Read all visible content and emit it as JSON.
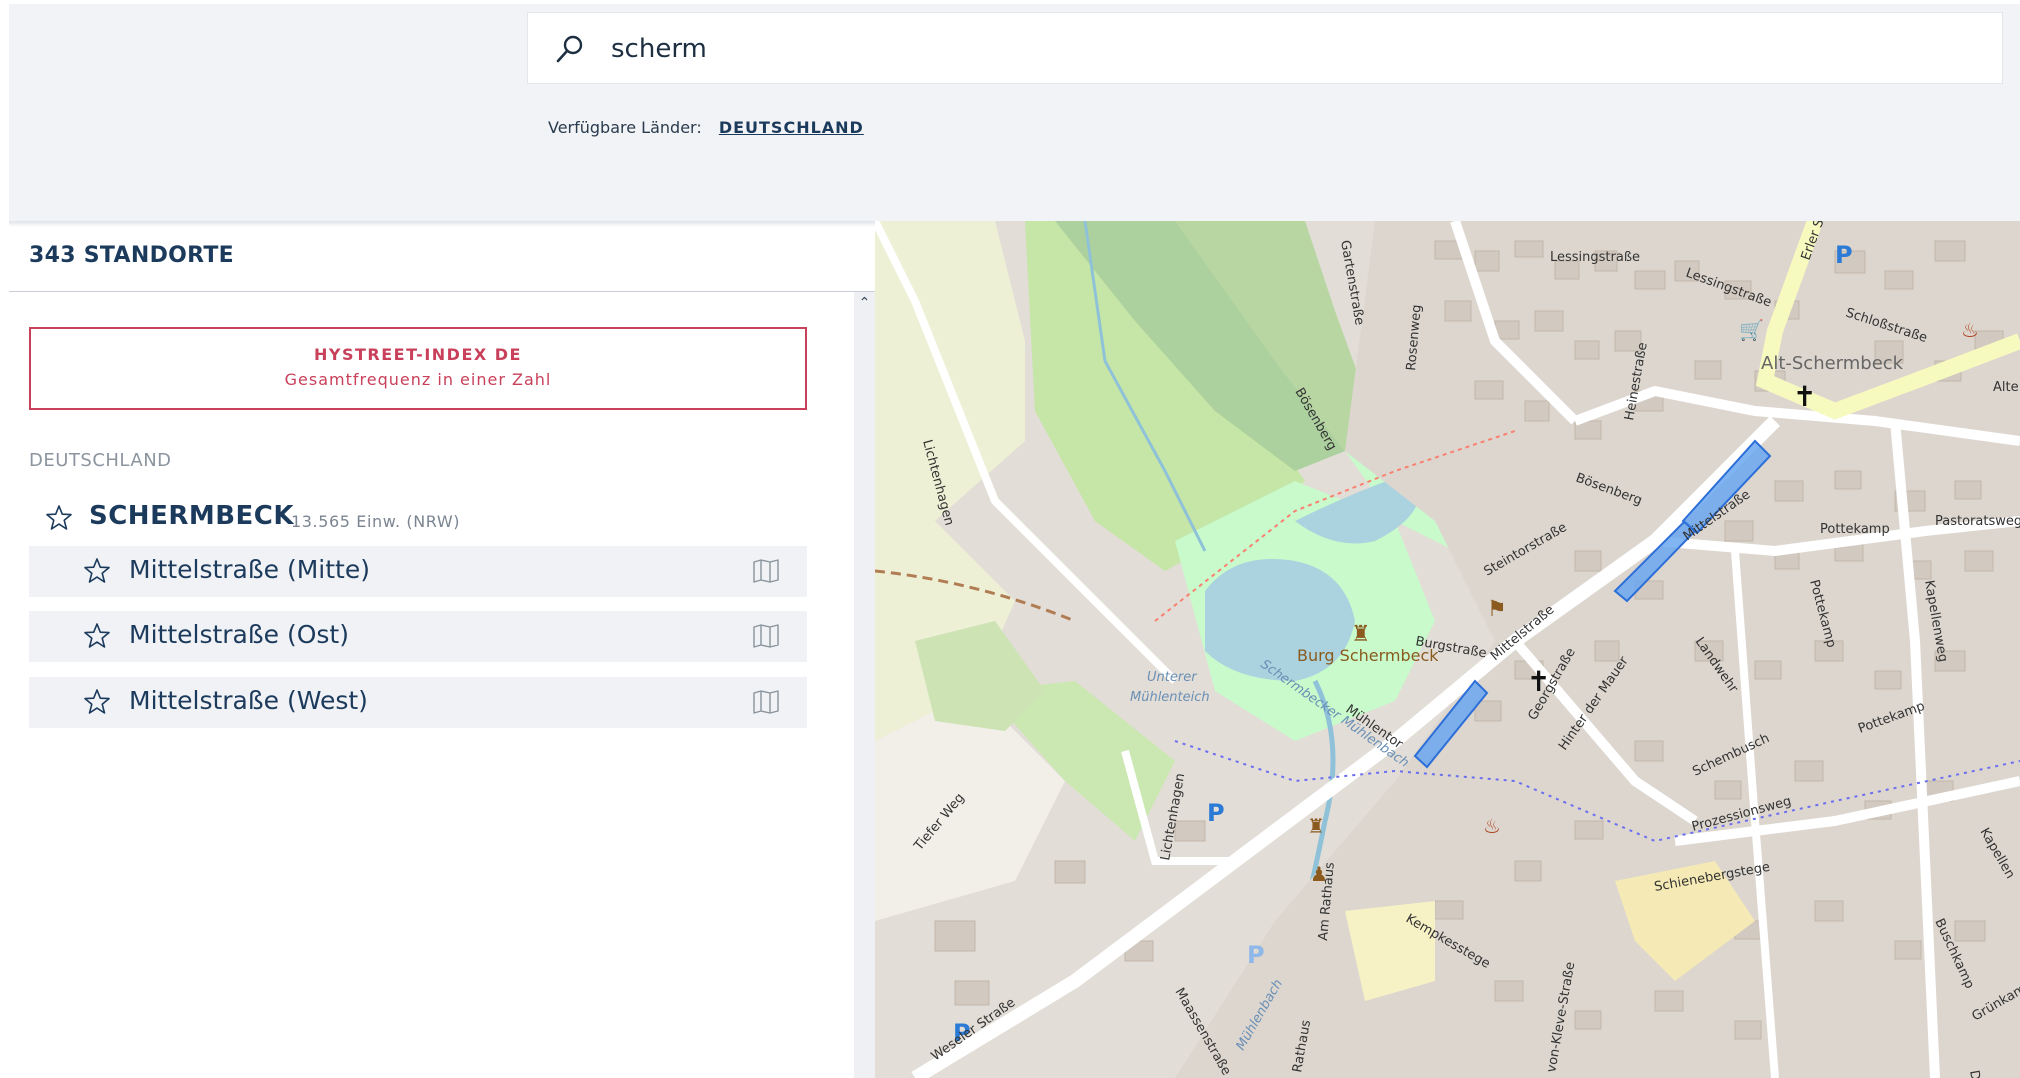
{
  "search": {
    "value": "scherm"
  },
  "countries": {
    "label": "Verfügbare Länder:",
    "link": "DEUTSCHLAND"
  },
  "results": {
    "count_label": "343 STANDORTE"
  },
  "hystreet": {
    "line1": "HYSTREET-INDEX DE",
    "line2": "Gesamtfrequenz in einer Zahl"
  },
  "country_group": "DEUTSCHLAND",
  "city": {
    "name": "SCHERMBECK",
    "meta": "13.565 Einw. (NRW)"
  },
  "locations": [
    {
      "name": "Mittelstraße (Mitte)"
    },
    {
      "name": "Mittelstraße (Ost)"
    },
    {
      "name": "Mittelstraße (West)"
    }
  ],
  "icons": [
    "search-icon",
    "star-icon",
    "map-icon",
    "chevron-up-icon",
    "parking-icon",
    "church-icon",
    "museum-icon",
    "castle-icon",
    "shopping-cart-icon",
    "fire-station-icon",
    "police-icon"
  ],
  "map": {
    "streets": [
      "Lessingstraße",
      "Lessingstraße",
      "Erler S",
      "Schloßstraße",
      "Alt-Schermbeck",
      "Alte",
      "Gartenstraße",
      "Rosenweg",
      "Bösenberg",
      "Heinestraße",
      "Bösenberg",
      "Mittelstraße",
      "Pottekamp",
      "Pastoratsweg",
      "Steintorstraße",
      "Pottekamp",
      "Kapellenweg",
      "Lichtenhagen",
      "Burgstraße",
      "Burg Schermbeck",
      "Mittelstraße",
      "Georgstraße",
      "Hinter der Mauer",
      "Landwehr",
      "Pottekamp",
      "Unterer",
      "Mühlenteich",
      "Schermbecker Mühlenbach",
      "Mühlentor",
      "Schembusch",
      "Prozessionsweg",
      "Kapellen",
      "Tiefer Weg",
      "Lichtenhagen",
      "Schienebergstege",
      "Am Rathaus",
      "Kempkesstege",
      "Buschkamp",
      "Grünkamp",
      "Weseler Straße",
      "Maassenstraße",
      "Mühlenbach",
      "Rathaus",
      "von-Kleve-Straße",
      "Dorst"
    ],
    "colors": {
      "highlight": "#4a8ee8",
      "water": "#aad3df",
      "park": "#c8facc",
      "forest": "#add19e",
      "background": "#e0dcd6",
      "road": "#ffffff",
      "major_road": "#f7fabf"
    }
  }
}
